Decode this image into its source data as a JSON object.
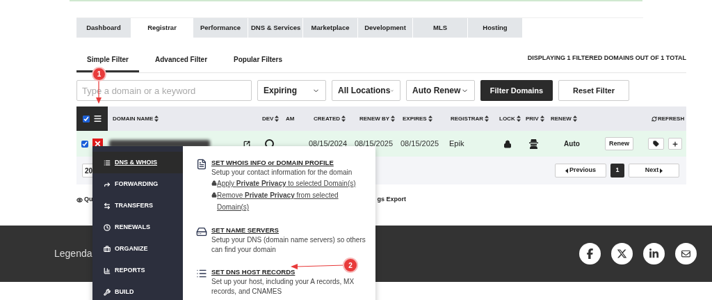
{
  "main_tabs": [
    {
      "label": "Dashboard",
      "selected": false
    },
    {
      "label": "Registrar",
      "selected": true
    },
    {
      "label": "Performance",
      "selected": false
    },
    {
      "label": "DNS & Services",
      "selected": false
    },
    {
      "label": "Marketplace",
      "selected": false
    },
    {
      "label": "Development",
      "selected": false
    },
    {
      "label": "MLS",
      "selected": false
    },
    {
      "label": "Hosting",
      "selected": false
    }
  ],
  "filter_tabs": [
    {
      "label": "Simple Filter",
      "selected": true
    },
    {
      "label": "Advanced Filter",
      "selected": false
    },
    {
      "label": "Popular Filters",
      "selected": false
    }
  ],
  "result_summary": "DISPLAYING 1 FILTERED DOMAINS OUT OF 1 TOTAL",
  "search": {
    "placeholder": "Type a domain or a keyword"
  },
  "dropdowns": [
    "Expiring",
    "All Locations",
    "Auto Renew"
  ],
  "buttons": {
    "filter": "Filter Domains",
    "reset": "Reset Filter"
  },
  "table": {
    "select_all_checked": true,
    "columns": [
      {
        "label": "DOMAIN NAME",
        "sortable": true
      },
      {
        "label": "DEV",
        "sortable": true
      },
      {
        "label": "AM",
        "sortable": false
      },
      {
        "label": "CREATED",
        "sortable": true
      },
      {
        "label": "RENEW BY",
        "sortable": true
      },
      {
        "label": "EXPIRES",
        "sortable": true
      },
      {
        "label": "REGISTRAR",
        "sortable": true
      },
      {
        "label": "LOCK",
        "sortable": true
      },
      {
        "label": "PRIV",
        "sortable": true
      },
      {
        "label": "RENEW",
        "sortable": true
      }
    ],
    "refresh": "REFRESH",
    "rows": [
      {
        "checked": true,
        "selected": true,
        "created": "08/15/2024",
        "renew_by": "08/15/2025",
        "expires": "08/15/2025",
        "registrar": "Epik",
        "renew": "Auto",
        "renew_button": "Renew"
      }
    ]
  },
  "page_size": "20",
  "pagination": {
    "previous": "Previous",
    "pages": [
      {
        "label": "1",
        "selected": true
      }
    ],
    "next": "Next"
  },
  "below_links": [
    "Qu",
    "gs Export"
  ],
  "footer": {
    "text": "Legenda"
  },
  "menu": {
    "items": [
      {
        "label": "DNS & WHOIS",
        "selected": true
      },
      {
        "label": "FORWARDING",
        "selected": false
      },
      {
        "label": "TRANSFERS",
        "selected": false
      },
      {
        "label": "RENEWALS",
        "selected": false
      },
      {
        "label": "ORGANIZE",
        "selected": false
      },
      {
        "label": "REPORTS",
        "selected": false
      },
      {
        "label": "BUILD",
        "selected": false
      }
    ],
    "sections": [
      {
        "title": "SET WHOIS INFO or DOMAIN PROFILE",
        "description": "Setup your contact information for the domain",
        "links": [
          " Apply **Private Privacy** to selected Domain(s)",
          " Remove **Private Privacy** from selected Domain(s)"
        ]
      },
      {
        "title": "SET NAME SERVERS",
        "description": "Setup your DNS (domain name servers) so others can find your domain"
      },
      {
        "title": "SET DNS HOST RECORDS",
        "description": "Set up your host, including your A records, MX records, and CNAMES"
      }
    ]
  },
  "annotations": [
    {
      "label": "1"
    },
    {
      "label": "2"
    }
  ]
}
